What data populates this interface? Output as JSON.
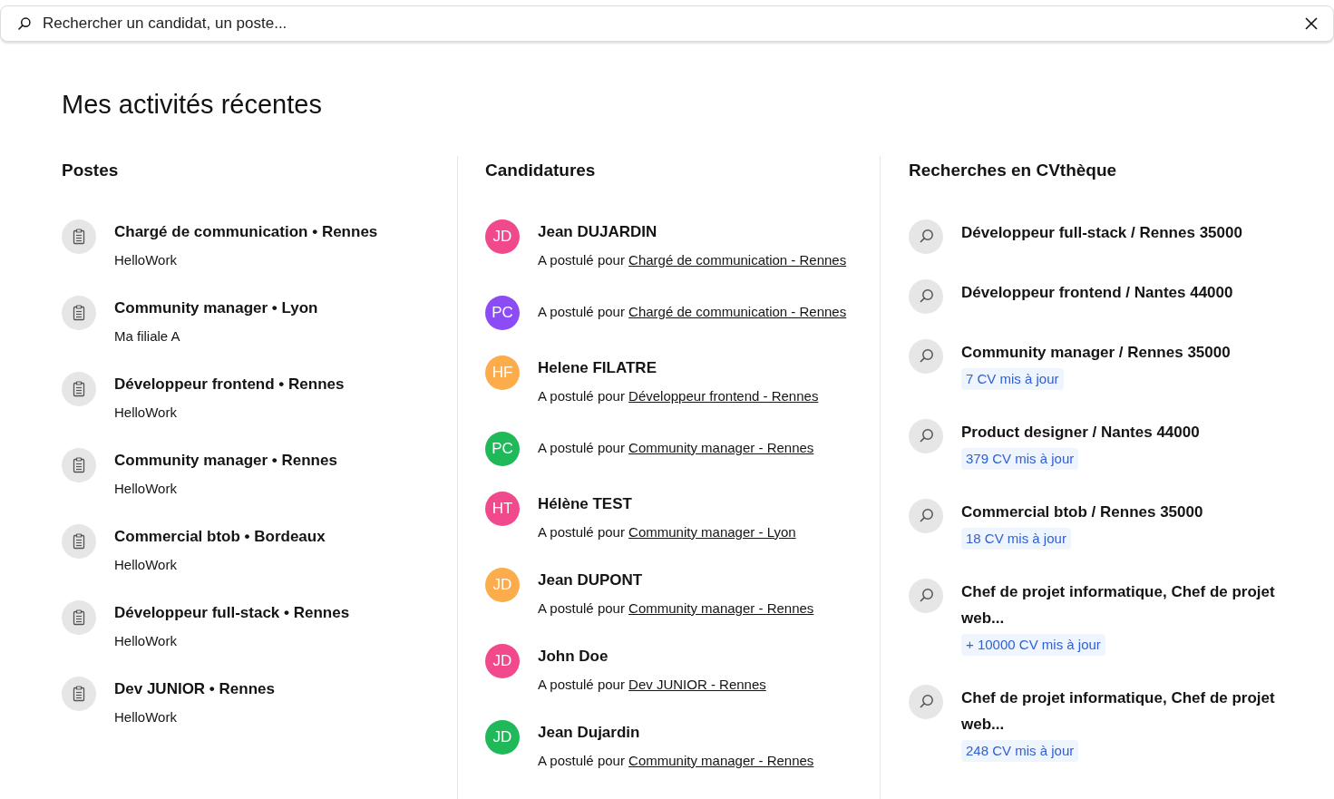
{
  "search": {
    "placeholder": "Rechercher un candidat, un poste..."
  },
  "heading": "Mes activités récentes",
  "postes": {
    "title": "Postes",
    "items": [
      {
        "title": "Chargé de communication • Rennes",
        "company": "HelloWork"
      },
      {
        "title": "Community manager • Lyon",
        "company": "Ma filiale A"
      },
      {
        "title": "Développeur frontend • Rennes",
        "company": "HelloWork"
      },
      {
        "title": "Community manager • Rennes",
        "company": "HelloWork"
      },
      {
        "title": "Commercial btob • Bordeaux",
        "company": "HelloWork"
      },
      {
        "title": "Développeur full-stack • Rennes",
        "company": "HelloWork"
      },
      {
        "title": "Dev JUNIOR • Rennes",
        "company": "HelloWork"
      }
    ]
  },
  "candidatures": {
    "title": "Candidatures",
    "items": [
      {
        "initials": "JD",
        "color": "#f1498b",
        "name": "Jean DUJARDIN",
        "text": "A postulé pour",
        "link": "Chargé de communication - Rennes"
      },
      {
        "initials": "PC",
        "color": "#8b4cf6",
        "text": "A postulé pour",
        "link": "Chargé de communication - Rennes"
      },
      {
        "initials": "HF",
        "color": "#fdac4c",
        "name": "Helene FILATRE",
        "text": "A postulé pour",
        "link": "Développeur frontend - Rennes"
      },
      {
        "initials": "PC",
        "color": "#1fb95a",
        "text": "A postulé pour",
        "link": "Community manager - Rennes"
      },
      {
        "initials": "HT",
        "color": "#f1498b",
        "name": "Hélène TEST",
        "text": "A postulé pour",
        "link": "Community manager - Lyon"
      },
      {
        "initials": "JD",
        "color": "#fdac4c",
        "name": "Jean DUPONT",
        "text": "A postulé pour",
        "link": "Community manager - Rennes"
      },
      {
        "initials": "JD",
        "color": "#f1498b",
        "name": "John Doe",
        "text": "A postulé pour",
        "link": "Dev JUNIOR - Rennes"
      },
      {
        "initials": "JD",
        "color": "#1fb95a",
        "name": "Jean Dujardin",
        "text": "A postulé pour",
        "link": "Community manager - Rennes"
      }
    ]
  },
  "recherches": {
    "title": "Recherches en CVthèque",
    "items": [
      {
        "query": "Développeur full-stack / Rennes 35000"
      },
      {
        "query": "Développeur frontend / Nantes 44000"
      },
      {
        "query": "Community manager / Rennes 35000",
        "badge": "7 CV mis à jour"
      },
      {
        "query": "Product designer / Nantes 44000",
        "badge": "379 CV mis à jour"
      },
      {
        "query": "Commercial btob / Rennes 35000",
        "badge": "18 CV mis à jour"
      },
      {
        "query": "Chef de projet informatique, Chef de projet web...",
        "badge": "+ 10000 CV mis à jour"
      },
      {
        "query": "Chef de projet informatique, Chef de projet web...",
        "badge": "248 CV mis à jour"
      }
    ]
  }
}
